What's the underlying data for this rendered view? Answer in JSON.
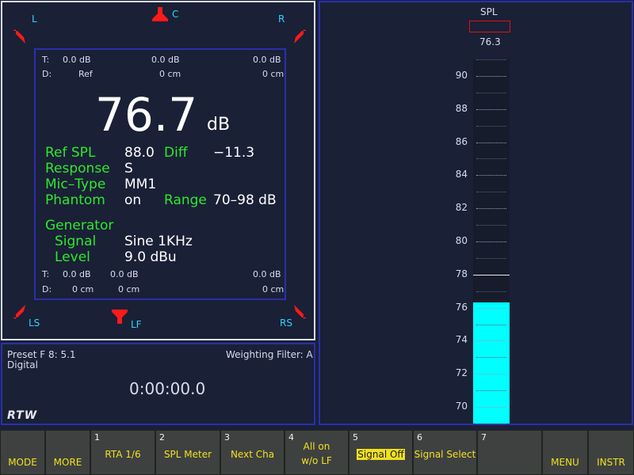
{
  "speakers": {
    "L": "L",
    "C": "C",
    "R": "R",
    "LS": "LS",
    "LF": "LF",
    "RS": "RS"
  },
  "top_rows": {
    "t_label": "T:",
    "t_values": [
      "0.0 dB",
      "0.0 dB",
      "0.0 dB"
    ],
    "d_label": "D:",
    "d_values": [
      "Ref",
      "0 cm",
      "0 cm"
    ]
  },
  "bottom_rows": {
    "t_label": "T:",
    "t_values": [
      "0.0 dB",
      "0.0 dB",
      "0.0 dB"
    ],
    "d_label": "D:",
    "d_values": [
      "0 cm",
      "0 cm",
      "0 cm"
    ]
  },
  "main_value": "76.7",
  "main_unit": "dB",
  "params": {
    "ref_spl_label": "Ref SPL",
    "ref_spl_value": "88.0",
    "diff_label": "Diff",
    "diff_value": "−11.3",
    "response_label": "Response",
    "response_value": "S",
    "mic_label": "Mic–Type",
    "mic_value": "MM1",
    "phantom_label": "Phantom",
    "phantom_value": "on",
    "range_label": "Range",
    "range_value": "70–98 dB"
  },
  "generator": {
    "title": "Generator",
    "signal_label": "Signal",
    "signal_value": "Sine 1KHz",
    "level_label": "Level",
    "level_value": "9.0 dBu"
  },
  "preset": {
    "name": "Preset F 8: 5.1",
    "source": "Digital",
    "weighting": "Weighting Filter: A",
    "timecode": "0:00:00.0",
    "logo": "RTW"
  },
  "meter": {
    "title": "SPL",
    "readout": "76.3",
    "value": 76.3,
    "peak_hold": 78,
    "min": 69,
    "max": 91,
    "ticks": [
      "90",
      "88",
      "86",
      "84",
      "82",
      "80",
      "78",
      "76",
      "74",
      "72",
      "70"
    ],
    "colors": {
      "bar": "#00ffff",
      "background": "#161c2c",
      "readout_box": "#e01010"
    }
  },
  "softkeys": {
    "mode": "MODE",
    "more": "MORE",
    "k1_num": "1",
    "k1": "RTA 1/6",
    "k2_num": "2",
    "k2": "SPL Meter",
    "k3_num": "3",
    "k3": "Next Cha",
    "k4_num": "4",
    "k4_line1": "All on",
    "k4_line2": "w/o LF",
    "k5_num": "5",
    "k5": "Signal Off",
    "k6_num": "6",
    "k6": "Signal Select",
    "k7_num": "7",
    "menu": "MENU",
    "instr": "INSTR"
  }
}
